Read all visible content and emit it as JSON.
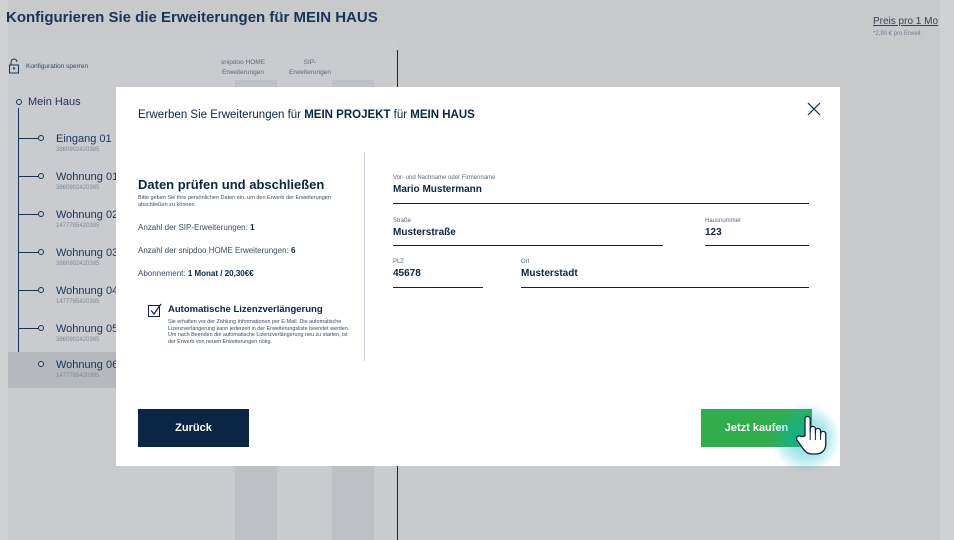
{
  "app": {
    "title": "Konfigurieren Sie die Erweiterungen für  MEIN HAUS",
    "price_link": "Preis pro 1 Mo",
    "price_note": "*2,90 € pro Erweit",
    "lock_label": "Konfiguration sperren",
    "col_snipdoo": "snipdoo HOME Erweiterungen",
    "col_sip": "SIP-\nErweiterungen",
    "tree": {
      "root": "Mein Haus",
      "items": [
        {
          "name": "Eingang 01",
          "code": "3860902420385"
        },
        {
          "name": "Wohnung 01",
          "code": "3860902420385"
        },
        {
          "name": "Wohnung 02",
          "code": "1477785420385"
        },
        {
          "name": "Wohnung 03",
          "code": "3860902420385"
        },
        {
          "name": "Wohnung 04",
          "code": "1477785420385"
        },
        {
          "name": "Wohnung 05",
          "code": "3860902420385"
        },
        {
          "name": "Wohnung 06",
          "code": "1477785420385"
        }
      ]
    }
  },
  "modal": {
    "title_prefix": "Erwerben Sie Erweiterungen für ",
    "title_project": "MEIN PROJEKT",
    "title_mid": " für ",
    "title_house": "MEIN HAUS",
    "summary": {
      "heading": "Daten prüfen und abschließen",
      "hint": "Bitte geben Sie Ihre persönlichen Daten ein, um den Erwerb der Erweiterungen abschließen zu können.",
      "sip_label": "Anzahl der SIP-Erweiterungen: ",
      "sip_value": "1",
      "snipdoo_label": "Anzahl der snipdoo HOME Erweiterungen: ",
      "snipdoo_value": "6",
      "abo_label": "Abonnement: ",
      "abo_value": "1 Monat / 20,30€€"
    },
    "renewal": {
      "title": "Automatische Lizenzverlängerung",
      "text": "Sie erhalten vor der Zahlung Informationen per E-Mail. Die automatische Lizenzverlängerung kann jederzeit in der Erweiterungsliste beendet werden. Um nach Beenden die automatische Lizenzverlängerung neu zu starten, ist der Erwerb von neuen Erweiterungen nötig."
    },
    "form": {
      "name_label": "Vor- und Nachname oder Firmenname",
      "name_value": "Mario Mustermann",
      "street_label": "Straße",
      "street_value": "Musterstraße",
      "number_label": "Hausnummer",
      "number_value": "123",
      "plz_label": "PLZ",
      "plz_value": "45678",
      "city_label": "Ort",
      "city_value": "Musterstadt"
    },
    "back_label": "Zurück",
    "buy_label": "Jetzt kaufen"
  },
  "colors": {
    "navy": "#0b2545",
    "buy_green": "#2fae4e",
    "cursor_glow": "#00b4c8"
  }
}
